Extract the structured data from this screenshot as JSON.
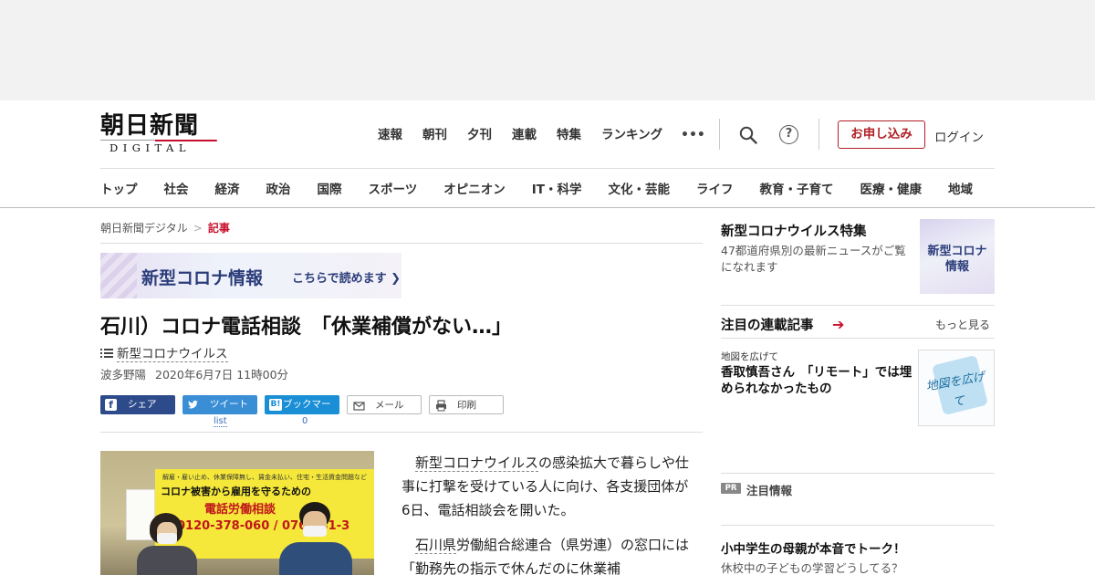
{
  "header": {
    "logo_jp": "朝日新聞",
    "logo_en": "DIGITAL",
    "topnav": [
      "速報",
      "朝刊",
      "夕刊",
      "連載",
      "特集",
      "ランキング"
    ],
    "more_label": "•••",
    "help_label": "?",
    "subscribe_label": "お申し込み",
    "login_label": "ログイン",
    "categories": [
      "トップ",
      "社会",
      "経済",
      "政治",
      "国際",
      "スポーツ",
      "オピニオン",
      "IT・科学",
      "文化・芸能",
      "ライフ",
      "教育・子育て",
      "医療・健康",
      "地域"
    ]
  },
  "breadcrumb": {
    "home": "朝日新聞デジタル",
    "sep": ">",
    "current": "記事"
  },
  "banner": {
    "title": "新型コロナ情報",
    "cta": "こちらで読めます ❯"
  },
  "article": {
    "title": "石川）コロナ電話相談　「休業補償がない…」",
    "topic": "新型コロナウイルス",
    "author": "波多野陽",
    "date": "2020年6月7日 11時00分",
    "share": {
      "facebook": "シェア",
      "twitter": "ツイート",
      "hatena": "ブックマーク",
      "hatena_icon": "B!",
      "mail": "メール",
      "print": "印刷",
      "twitter_count": "list",
      "hatena_count": "0"
    },
    "photo": {
      "poster_line1": "解雇・雇い止め、休業保障無し、賃金未払い、住宅・生活資金問題など",
      "poster_line2": "コロナ被害から雇用を守るための",
      "poster_line3": "電話労働相談",
      "poster_line4": "0120-378-060 / 076-231-3"
    },
    "p1_link": "新型コロナウイルス",
    "p1_rest": "の感染拡大で暮らしや仕事に打撃を受けている人に向け、各支援団体が6日、電話相談会を開いた。",
    "p2_link": "石川県",
    "p2_rest": "労働組合総連合（県労連）の窓口には「勤務先の指示で休んだのに休業補"
  },
  "sidebar": {
    "feature": {
      "title": "新型コロナウイルス特集",
      "desc": "47都道府県別の最新ニュースがご覧になれます",
      "thumb": "新型コロナ\n情報"
    },
    "rensai": {
      "title": "注目の連載記事",
      "arrow": "➔",
      "more": "もっと見る",
      "kicker": "地図を広げて",
      "headline": "香取慎吾さん　「リモート」では埋められなかったもの",
      "thumb_text": "地図を広げて"
    },
    "pr": {
      "badge": "PR",
      "label": "注目情報",
      "headline": "小中学生の母親が本音でトーク！",
      "sub": "休校中の子どもの学習どうしてる？"
    }
  },
  "colors": {
    "brand_red": "#c8102e",
    "facebook": "#2d4a8a",
    "twitter": "#3a8ed6",
    "hatena": "#1a8fd6"
  }
}
